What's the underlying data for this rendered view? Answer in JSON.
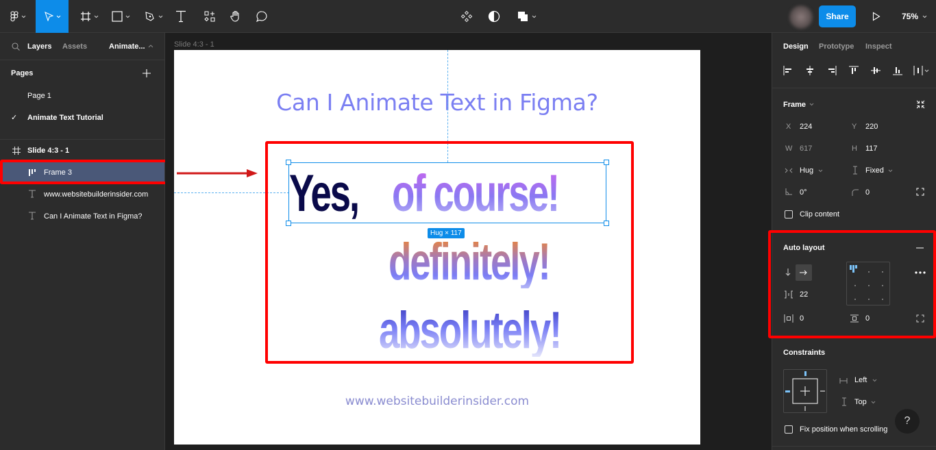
{
  "toolbar": {
    "tools": [
      {
        "name": "figma-menu",
        "icon": "figma-logo-icon"
      },
      {
        "name": "move",
        "icon": "move-cursor-icon",
        "active": true
      },
      {
        "name": "frame",
        "icon": "frame-hash-icon"
      },
      {
        "name": "shape",
        "icon": "rectangle-icon"
      },
      {
        "name": "pen",
        "icon": "pen-icon"
      },
      {
        "name": "text",
        "icon": "text-icon"
      },
      {
        "name": "resources",
        "icon": "resources-icon"
      },
      {
        "name": "hand",
        "icon": "hand-icon"
      },
      {
        "name": "comment",
        "icon": "comment-icon"
      }
    ],
    "center_icons": [
      "components-icon",
      "contrast-icon",
      "boolean-icon"
    ],
    "share_label": "Share",
    "zoom_level": "75%"
  },
  "left_panel": {
    "tabs": {
      "layers": "Layers",
      "assets": "Assets",
      "page_selector": "Animate..."
    },
    "pages_heading": "Pages",
    "pages": [
      {
        "label": "Page 1",
        "current": false
      },
      {
        "label": "Animate Text Tutorial",
        "current": true
      }
    ],
    "layers": [
      {
        "label": "Slide 4:3 - 1",
        "type": "frame",
        "level": 0
      },
      {
        "label": "Frame 3",
        "type": "auto-layout-frame",
        "level": 1,
        "selected": true
      },
      {
        "label": "www.websitebuilderinsider.com",
        "type": "text",
        "level": 1
      },
      {
        "label": "Can I Animate Text in Figma?",
        "type": "text",
        "level": 1
      }
    ]
  },
  "canvas": {
    "frame_label": "Slide 4:3 - 1",
    "slide": {
      "title": "Can I Animate Text in Figma?",
      "word_yes": "Yes,",
      "word_course": "of course!",
      "word_definitely": "definitely!",
      "word_absolutely": "absolutely!",
      "url": "www.websitebuilderinsider.com"
    },
    "selection_badge": "Hug × 117"
  },
  "right_panel": {
    "tabs": {
      "design": "Design",
      "prototype": "Prototype",
      "inspect": "Inspect"
    },
    "frame": {
      "heading": "Frame",
      "x_label": "X",
      "x": "224",
      "y_label": "Y",
      "y": "220",
      "w_label": "W",
      "w": "617",
      "h_label": "H",
      "h": "117",
      "width_mode": "Hug",
      "height_mode": "Fixed",
      "rotation": "0°",
      "radius": "0",
      "clip_content": "Clip content"
    },
    "auto_layout": {
      "heading": "Auto layout",
      "direction": "horizontal",
      "spacing": "22",
      "h_padding": "0",
      "v_padding": "0"
    },
    "constraints": {
      "heading": "Constraints",
      "horizontal": "Left",
      "vertical": "Top",
      "fix_position": "Fix position when scrolling"
    }
  },
  "help_label": "?",
  "colors": {
    "accent": "#0d8ce9",
    "annotation_red": "#ff0000",
    "selected_layer": "#4a5878",
    "title_purple": "#7b7ff2"
  }
}
